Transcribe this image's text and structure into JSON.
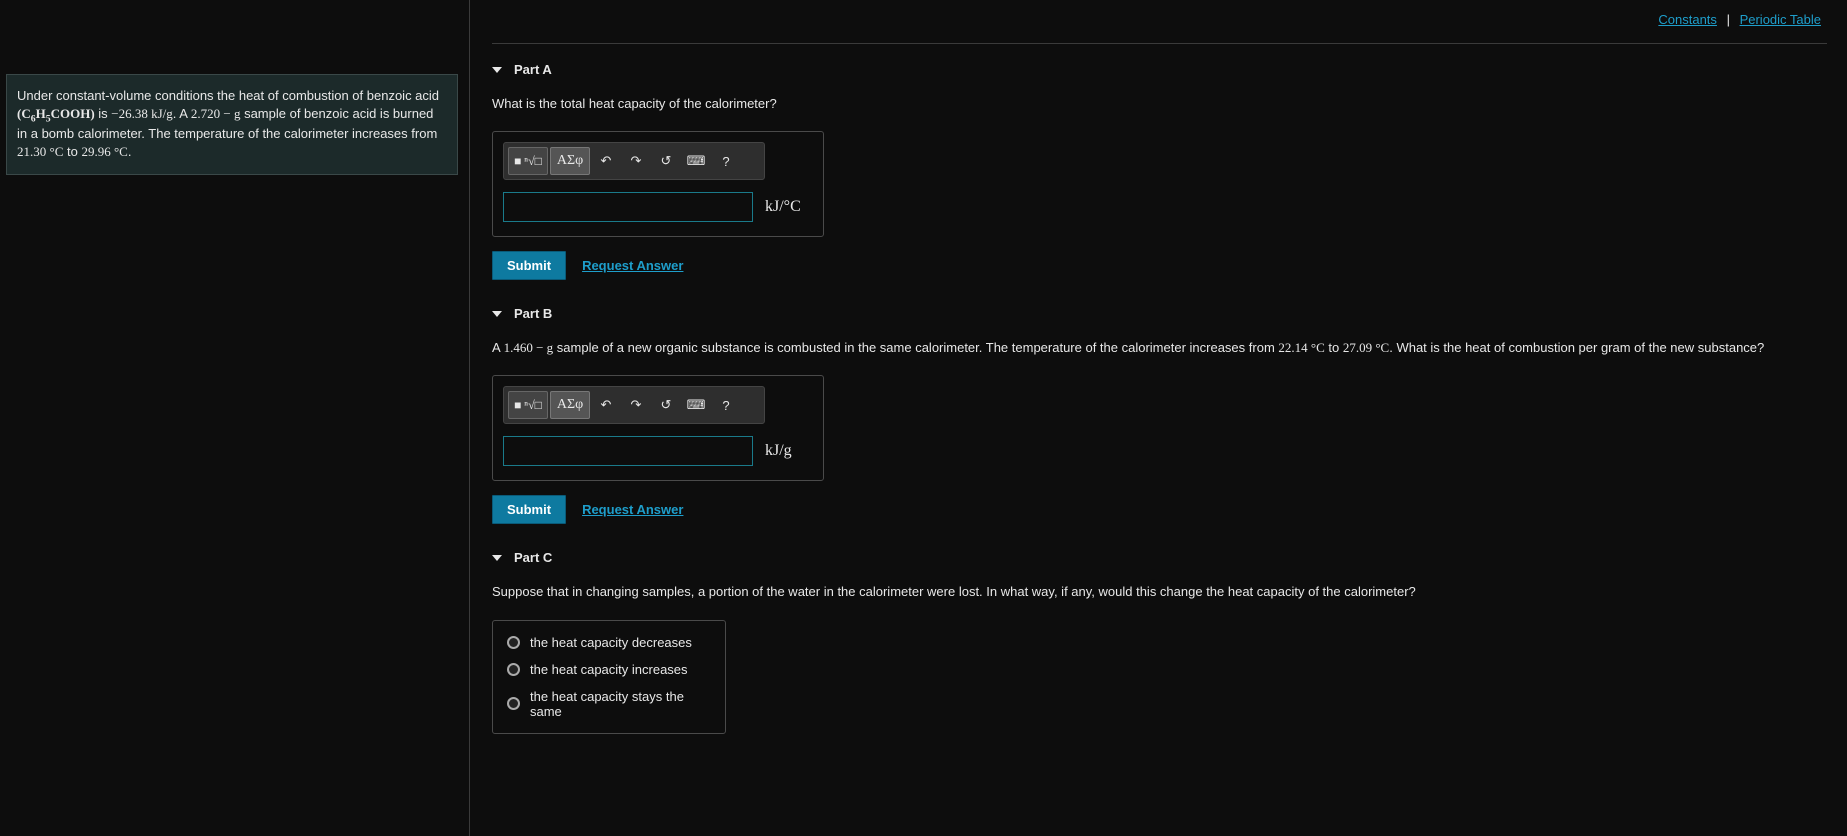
{
  "top_links": {
    "constants": "Constants",
    "periodic": "Periodic Table"
  },
  "problem": {
    "text_1": "Under constant-volume conditions the heat of combustion of benzoic acid ",
    "formula": "(C₆H₅COOH)",
    "text_2": " is ",
    "val_heat": "−26.38 kJ/g",
    "text_3": ". A ",
    "val_mass": "2.720 − g",
    "text_4": " sample of benzoic acid is burned in a bomb calorimeter. The temperature of the calorimeter increases from ",
    "t_from": "21.30 °C",
    "text_5": " to ",
    "t_to": "29.96 °C",
    "text_6": "."
  },
  "toolbar": {
    "templates": "■ ⁿ√□",
    "greek": "ΑΣφ",
    "undo": "↶",
    "redo": "↷",
    "reset": "↺",
    "keyboard": "⌨",
    "help": "?"
  },
  "common": {
    "submit": "Submit",
    "request": "Request Answer"
  },
  "partA": {
    "title": "Part A",
    "prompt": "What is the total heat capacity of the calorimeter?",
    "unit": "kJ/°C"
  },
  "partB": {
    "title": "Part B",
    "prompt_1": "A ",
    "mass": "1.460 − g",
    "prompt_2": " sample of a new organic substance is combusted in the same calorimeter. The temperature of the calorimeter increases from ",
    "t_from": "22.14 °C",
    "prompt_3": " to ",
    "t_to": "27.09 °C",
    "prompt_4": ". What is the heat of combustion per gram of the new substance?",
    "unit": "kJ/g"
  },
  "partC": {
    "title": "Part C",
    "prompt": "Suppose that in changing samples, a portion of the water in the calorimeter were lost. In what way, if any, would this change the heat capacity of the calorimeter?",
    "options": [
      "the heat capacity decreases",
      "the heat capacity increases",
      "the heat capacity stays the same"
    ]
  }
}
